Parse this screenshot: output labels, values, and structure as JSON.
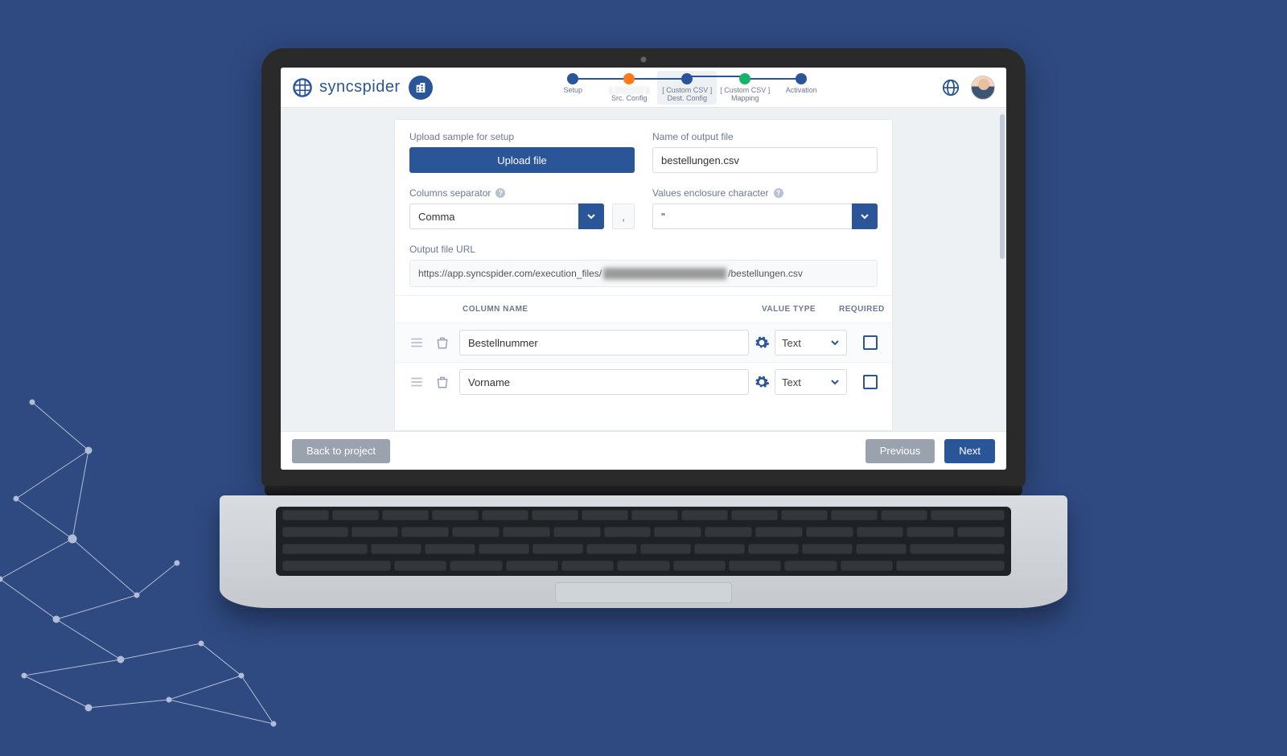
{
  "brand": {
    "name": "syncspider"
  },
  "stepper": [
    {
      "top": "",
      "bottom": "Setup",
      "color": "#2b5599"
    },
    {
      "top": "[ ░░░░░░ ]",
      "bottom": "Src. Config",
      "color": "#ff7a1a"
    },
    {
      "top": "[ Custom CSV ]",
      "bottom": "Dest. Config",
      "color": "#2b5599",
      "active": true
    },
    {
      "top": "[ Custom CSV ]",
      "bottom": "Mapping",
      "color": "#18b36b"
    },
    {
      "top": "",
      "bottom": "Activation",
      "color": "#2b5599"
    }
  ],
  "form": {
    "upload_label": "Upload sample for setup",
    "upload_btn": "Upload file",
    "name_label": "Name of output file",
    "name_value": "bestellungen.csv",
    "sep_label": "Columns separator",
    "sep_value": "Comma",
    "sep_preview": ",",
    "enc_label": "Values enclosure character",
    "enc_value": "\"",
    "url_label": "Output file URL",
    "url_pre": "https://app.syncspider.com/execution_files/",
    "url_hidden": "██████████████████",
    "url_post": "/bestellungen.csv"
  },
  "table": {
    "h_name": "COLUMN NAME",
    "h_type": "VALUE TYPE",
    "h_req": "REQUIRED",
    "rows": [
      {
        "name": "Bestellnummer",
        "type": "Text"
      },
      {
        "name": "Vorname",
        "type": "Text"
      }
    ]
  },
  "footer": {
    "back": "Back to project",
    "prev": "Previous",
    "next": "Next"
  }
}
